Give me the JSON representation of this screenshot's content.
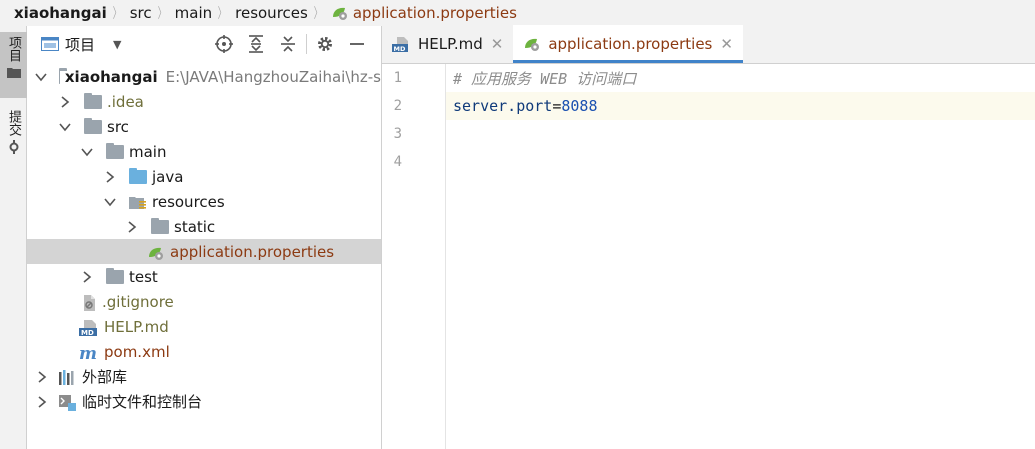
{
  "breadcrumb": {
    "project": "xiaohangai",
    "items": [
      "src",
      "main",
      "resources"
    ],
    "file": "application.properties"
  },
  "toolstrip": {
    "project_label": "项目",
    "commit_label": "提交"
  },
  "project_panel": {
    "title": "项目",
    "tree": {
      "root_name": "xiaohangai",
      "root_path": "E:\\JAVA\\HangzhouZaihai\\hz-s",
      "idea": ".idea",
      "src": "src",
      "main": "main",
      "java": "java",
      "resources": "resources",
      "static": "static",
      "app_props": "application.properties",
      "test": "test",
      "gitignore": ".gitignore",
      "help_md": "HELP.md",
      "pom": "pom.xml",
      "external_libs": "外部库",
      "scratches": "临时文件和控制台"
    }
  },
  "editor": {
    "tabs": [
      {
        "label": "HELP.md",
        "active": false
      },
      {
        "label": "application.properties",
        "active": true
      }
    ],
    "line_numbers": [
      "1",
      "2",
      "3",
      "4"
    ],
    "lines": {
      "comment": "# 应用服务 WEB 访问端口",
      "key": "server.port",
      "eq": "=",
      "value": "8088"
    }
  },
  "colors": {
    "accent_tab_underline": "#4083c9",
    "file_modified": "#8c3a12",
    "selected_row": "#d4d4d4"
  }
}
